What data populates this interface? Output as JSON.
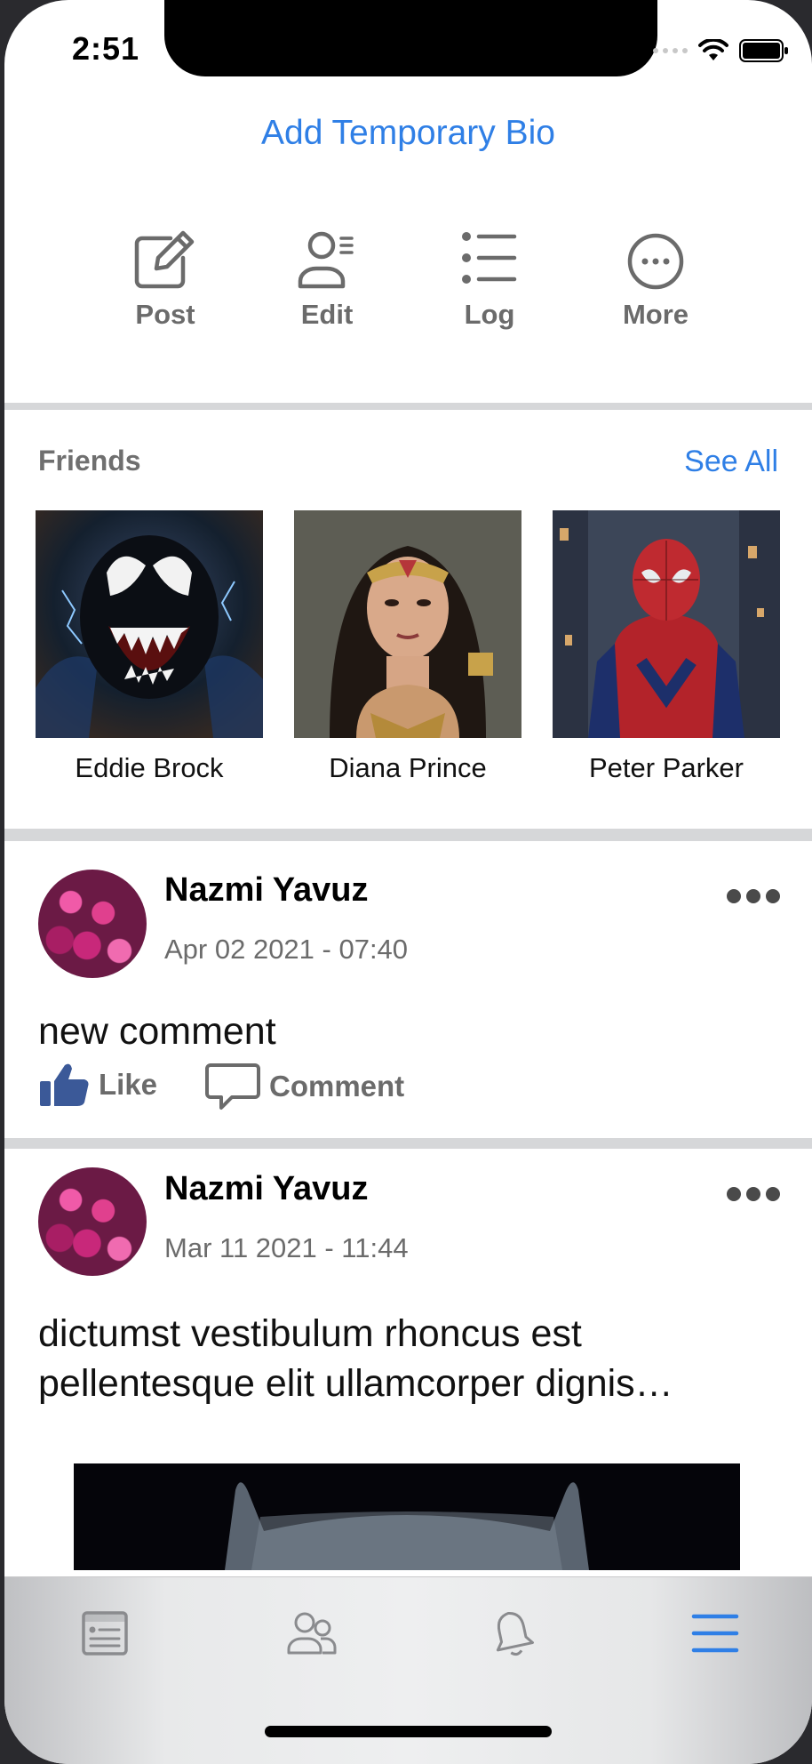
{
  "status_bar": {
    "time": "2:51"
  },
  "profile": {
    "add_bio_label": "Add Temporary Bio"
  },
  "actions": [
    {
      "label": "Post",
      "icon": "edit-pencil-icon"
    },
    {
      "label": "Edit",
      "icon": "user-edit-icon"
    },
    {
      "label": "Log",
      "icon": "list-icon"
    },
    {
      "label": "More",
      "icon": "more-circle-icon"
    }
  ],
  "friends": {
    "title": "Friends",
    "see_all_label": "See All",
    "items": [
      {
        "name": "Eddie Brock"
      },
      {
        "name": "Diana Prince"
      },
      {
        "name": "Peter Parker"
      }
    ]
  },
  "posts": [
    {
      "author": "Nazmi Yavuz",
      "date": "Apr 02 2021 - 07:40",
      "text": "new comment",
      "like_label": "Like",
      "comment_label": "Comment"
    },
    {
      "author": "Nazmi Yavuz",
      "date": "Mar 11 2021 - 11:44",
      "text": "dictumst vestibulum rhoncus est pellentesque elit ullamcorper dignis…"
    }
  ],
  "tab_bar": {
    "tabs": [
      {
        "icon": "news-feed-icon",
        "active": false
      },
      {
        "icon": "friends-icon",
        "active": false
      },
      {
        "icon": "bell-icon",
        "active": false
      },
      {
        "icon": "menu-icon",
        "active": true
      }
    ],
    "active_color": "#2f7fe6",
    "inactive_color": "#8a8b8e"
  },
  "colors": {
    "accent": "#2f7fe6",
    "like": "#3b5998"
  }
}
